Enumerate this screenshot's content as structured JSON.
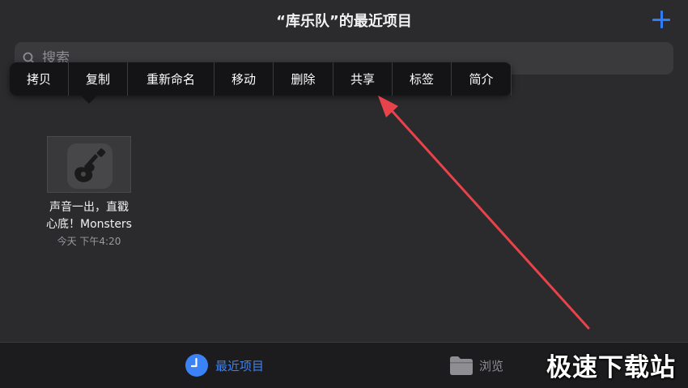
{
  "header": {
    "title": "“库乐队”的最近项目",
    "add_icon": "plus-icon"
  },
  "search": {
    "placeholder": "搜索",
    "icon": "search-icon"
  },
  "context_menu": {
    "items": [
      {
        "label": "拷贝"
      },
      {
        "label": "复制"
      },
      {
        "label": "重新命名"
      },
      {
        "label": "移动"
      },
      {
        "label": "删除"
      },
      {
        "label": "共享"
      },
      {
        "label": "标签"
      },
      {
        "label": "简介"
      }
    ]
  },
  "file": {
    "name_line1": "声音一出，直戳",
    "name_line2": "心底！Monsters",
    "date": "今天 下午4:20",
    "icon": "guitar-icon"
  },
  "tabbar": {
    "recent_label": "最近项目",
    "recent_icon": "clock-icon",
    "browse_label": "浏览",
    "browse_icon": "folder-icon"
  },
  "watermark": {
    "text": "极速下载站"
  },
  "colors": {
    "accent": "#3b82f6",
    "arrow": "#e8434a",
    "background": "#2b2b2d"
  }
}
